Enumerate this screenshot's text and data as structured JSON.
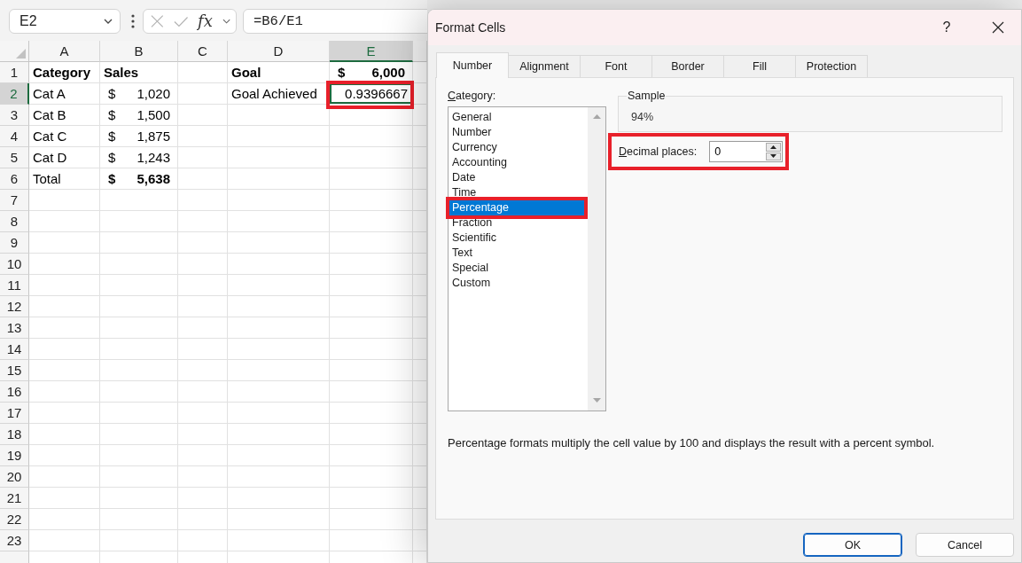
{
  "formula_bar": {
    "name_box": "E2",
    "function_label": "fx",
    "formula": "=B6/E1"
  },
  "sheet": {
    "columns": [
      {
        "label": "A",
        "selected": false
      },
      {
        "label": "B",
        "selected": false
      },
      {
        "label": "C",
        "selected": false
      },
      {
        "label": "D",
        "selected": false
      },
      {
        "label": "E",
        "selected": true
      }
    ],
    "active_cell_highlighted": true,
    "rows": [
      {
        "label": "1",
        "selected": false,
        "cells": [
          {
            "kind": "text",
            "text": "Category",
            "bold": true
          },
          {
            "kind": "text",
            "text": "Sales",
            "bold": true
          },
          {
            "kind": "blank"
          },
          {
            "kind": "text",
            "text": "Goal",
            "bold": true
          },
          {
            "kind": "accounting",
            "symbol": "$",
            "text": "6,000",
            "bold": true
          }
        ]
      },
      {
        "label": "2",
        "selected": true,
        "cells": [
          {
            "kind": "text",
            "text": "Cat A",
            "bold": false
          },
          {
            "kind": "accounting",
            "symbol": "$",
            "text": "1,020",
            "bold": false
          },
          {
            "kind": "blank"
          },
          {
            "kind": "text",
            "text": "Goal Achieved",
            "bold": false
          },
          {
            "kind": "number",
            "text": "0.9396667",
            "bold": false
          }
        ]
      },
      {
        "label": "3",
        "selected": false,
        "cells": [
          {
            "kind": "text",
            "text": "Cat B",
            "bold": false
          },
          {
            "kind": "accounting",
            "symbol": "$",
            "text": "1,500",
            "bold": false
          }
        ]
      },
      {
        "label": "4",
        "selected": false,
        "cells": [
          {
            "kind": "text",
            "text": "Cat C",
            "bold": false
          },
          {
            "kind": "accounting",
            "symbol": "$",
            "text": "1,875",
            "bold": false
          }
        ]
      },
      {
        "label": "5",
        "selected": false,
        "cells": [
          {
            "kind": "text",
            "text": "Cat D",
            "bold": false
          },
          {
            "kind": "accounting",
            "symbol": "$",
            "text": "1,243",
            "bold": false
          }
        ]
      },
      {
        "label": "6",
        "selected": false,
        "cells": [
          {
            "kind": "text",
            "text": "Total",
            "bold": false
          },
          {
            "kind": "accounting",
            "symbol": "$",
            "text": "5,638",
            "bold": true
          }
        ]
      },
      {
        "label": "7",
        "selected": false
      },
      {
        "label": "8",
        "selected": false
      },
      {
        "label": "9",
        "selected": false
      },
      {
        "label": "10",
        "selected": false
      },
      {
        "label": "11",
        "selected": false
      },
      {
        "label": "12",
        "selected": false
      },
      {
        "label": "13",
        "selected": false
      },
      {
        "label": "14",
        "selected": false
      },
      {
        "label": "15",
        "selected": false
      },
      {
        "label": "16",
        "selected": false
      },
      {
        "label": "17",
        "selected": false
      },
      {
        "label": "18",
        "selected": false
      },
      {
        "label": "19",
        "selected": false
      },
      {
        "label": "20",
        "selected": false
      },
      {
        "label": "21",
        "selected": false
      },
      {
        "label": "22",
        "selected": false
      },
      {
        "label": "23",
        "selected": false
      }
    ]
  },
  "dialog": {
    "title": "Format Cells",
    "help": "?",
    "tabs": [
      {
        "label": "Number",
        "selected": true
      },
      {
        "label": "Alignment",
        "selected": false
      },
      {
        "label": "Font",
        "selected": false
      },
      {
        "label": "Border",
        "selected": false
      },
      {
        "label": "Fill",
        "selected": false
      },
      {
        "label": "Protection",
        "selected": false
      }
    ],
    "category": {
      "label": "Category:",
      "highlighted": true,
      "items": [
        {
          "label": "General",
          "selected": false
        },
        {
          "label": "Number",
          "selected": false
        },
        {
          "label": "Currency",
          "selected": false
        },
        {
          "label": "Accounting",
          "selected": false
        },
        {
          "label": "Date",
          "selected": false
        },
        {
          "label": "Time",
          "selected": false
        },
        {
          "label": "Percentage",
          "selected": true
        },
        {
          "label": "Fraction",
          "selected": false
        },
        {
          "label": "Scientific",
          "selected": false
        },
        {
          "label": "Text",
          "selected": false
        },
        {
          "label": "Special",
          "selected": false
        },
        {
          "label": "Custom",
          "selected": false
        }
      ]
    },
    "sample": {
      "label": "Sample",
      "value": "94%"
    },
    "decimal_places": {
      "label": "Decimal places:",
      "value": "0",
      "highlighted": true
    },
    "description": "Percentage formats multiply the cell value by 100 and displays the result with a percent symbol.",
    "buttons": [
      {
        "label": "OK",
        "default": true
      },
      {
        "label": "Cancel",
        "default": false
      }
    ]
  }
}
